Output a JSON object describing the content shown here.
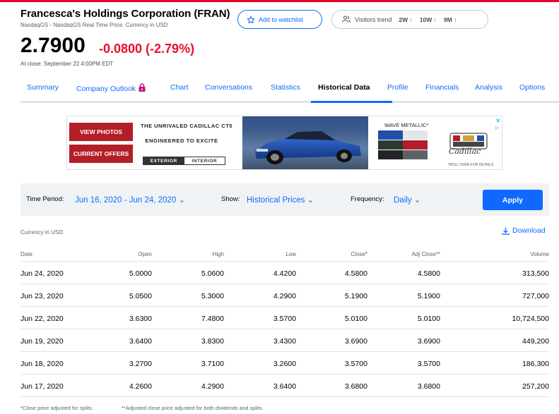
{
  "header": {
    "company": "Francesca's Holdings Corporation (FRAN)",
    "subtitle": "NasdaqGS - NasdaqGS Real Time Price. Currency in USD",
    "watchlist_label": "Add to watchlist",
    "visitors_label": "Visitors trend",
    "trends": [
      {
        "period": "2W",
        "arrow": "↑"
      },
      {
        "period": "10W",
        "arrow": "↑"
      },
      {
        "period": "9M",
        "arrow": "↑"
      }
    ]
  },
  "quote": {
    "price": "2.7900",
    "change": "-0.0800 (-2.79%)",
    "close_time": "At close: September 22 4:00PM EDT"
  },
  "tabs": [
    {
      "label": "Summary"
    },
    {
      "label": "Company Outlook"
    },
    {
      "label": "Chart"
    },
    {
      "label": "Conversations"
    },
    {
      "label": "Statistics"
    },
    {
      "label": "Historical Data"
    },
    {
      "label": "Profile"
    },
    {
      "label": "Financials"
    },
    {
      "label": "Analysis"
    },
    {
      "label": "Options"
    }
  ],
  "active_tab": "Historical Data",
  "ad": {
    "view_photos": "VIEW PHOTOS",
    "current_offers": "CURRENT OFFERS",
    "headline": "THE UNRIVALED CADILLAC CT5",
    "tagline": "ENGINEERED TO EXCITE",
    "exterior": "EXTERIOR",
    "interior": "INTERIOR",
    "swatch_title": "WAVE METALLIC*",
    "brand": "Cadillac",
    "rollover": "*ROLL OVER FOR DETAILS",
    "swatch_colors": [
      "#1f4fa8",
      "#e3e5e8",
      "#2a3a2f",
      "#b01e2a",
      "#222427",
      "#5e6166"
    ]
  },
  "filters": {
    "time_period_label": "Time Period:",
    "time_period_value": "Jun 16, 2020 - Jun 24, 2020",
    "show_label": "Show:",
    "show_value": "Historical Prices",
    "frequency_label": "Frequency:",
    "frequency_value": "Daily",
    "apply_label": "Apply"
  },
  "table": {
    "currency": "Currency in USD",
    "download_label": "Download",
    "columns": [
      "Date",
      "Open",
      "High",
      "Low",
      "Close*",
      "Adj Close**",
      "Volume"
    ],
    "rows": [
      [
        "Jun 24, 2020",
        "5.0000",
        "5.0600",
        "4.4200",
        "4.5800",
        "4.5800",
        "313,500"
      ],
      [
        "Jun 23, 2020",
        "5.0500",
        "5.3000",
        "4.2900",
        "5.1900",
        "5.1900",
        "727,000"
      ],
      [
        "Jun 22, 2020",
        "3.6300",
        "7.4800",
        "3.5700",
        "5.0100",
        "5.0100",
        "10,724,500"
      ],
      [
        "Jun 19, 2020",
        "3.6400",
        "3.8300",
        "3.4300",
        "3.6900",
        "3.6900",
        "449,200"
      ],
      [
        "Jun 18, 2020",
        "3.2700",
        "3.7100",
        "3.2600",
        "3.5700",
        "3.5700",
        "186,300"
      ],
      [
        "Jun 17, 2020",
        "4.2600",
        "4.2900",
        "3.6400",
        "3.6800",
        "3.6800",
        "257,200"
      ]
    ],
    "footnote_close": "*Close price adjusted for splits.",
    "footnote_adj": "**Adjusted close price adjusted for both dividends and splits."
  },
  "colors": {
    "accent": "#0f69ff",
    "negative": "#eb0f29",
    "positive": "#00a050",
    "brand_bar": "#e6002b"
  }
}
